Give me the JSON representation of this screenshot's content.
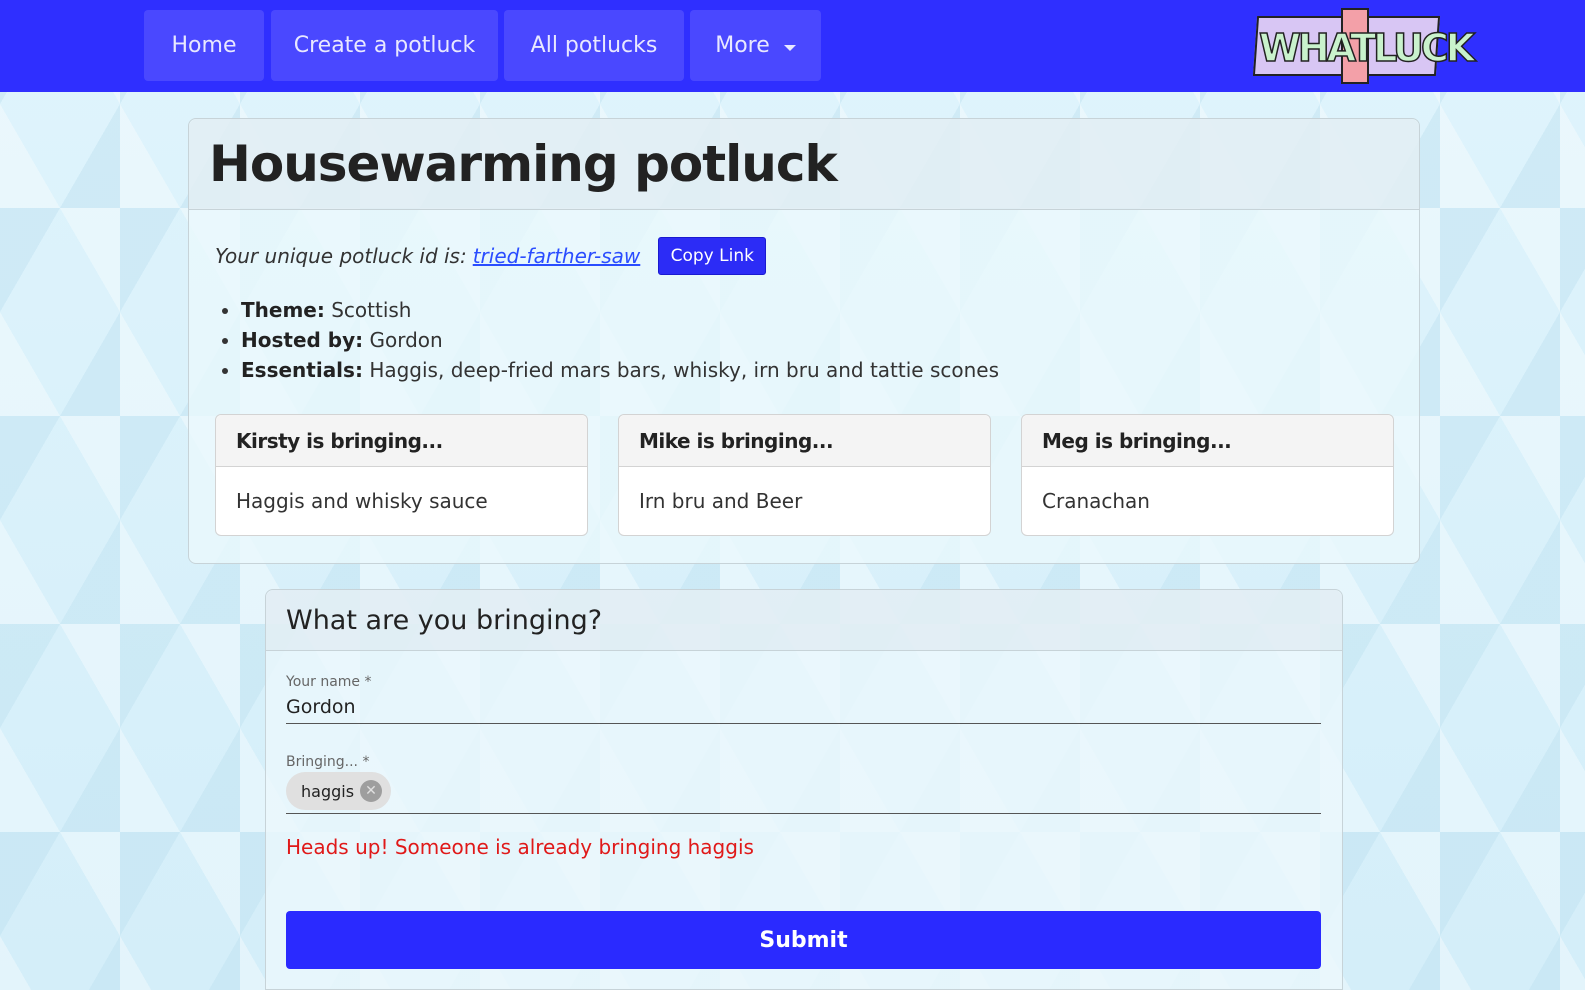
{
  "nav": {
    "home": "Home",
    "create": "Create a potluck",
    "all": "All potlucks",
    "more": "More"
  },
  "logo": {
    "text": "WHATLUCK"
  },
  "potluck": {
    "title": "Housewarming potluck",
    "id_prefix": "Your unique potluck id is:",
    "id": "tried-farther-saw",
    "copy_label": "Copy Link",
    "details": [
      {
        "label": "Theme:",
        "value": "Scottish"
      },
      {
        "label": "Hosted by:",
        "value": "Gordon"
      },
      {
        "label": "Essentials:",
        "value": "Haggis, deep-fried mars bars, whisky, irn bru and tattie scones"
      }
    ],
    "contributions": [
      {
        "heading": "Kirsty is bringing...",
        "item": "Haggis and whisky sauce"
      },
      {
        "heading": "Mike is bringing...",
        "item": "Irn bru and Beer"
      },
      {
        "heading": "Meg is bringing...",
        "item": "Cranachan"
      }
    ]
  },
  "form": {
    "heading": "What are you bringing?",
    "name_label": "Your name *",
    "name_value": "Gordon",
    "bringing_label": "Bringing... *",
    "chip": "haggis",
    "warning": "Heads up! Someone is already bringing haggis",
    "submit": "Submit"
  },
  "colors": {
    "nav_bg": "#2f2fff",
    "accent": "#2a2aff",
    "warning": "#e01919"
  }
}
